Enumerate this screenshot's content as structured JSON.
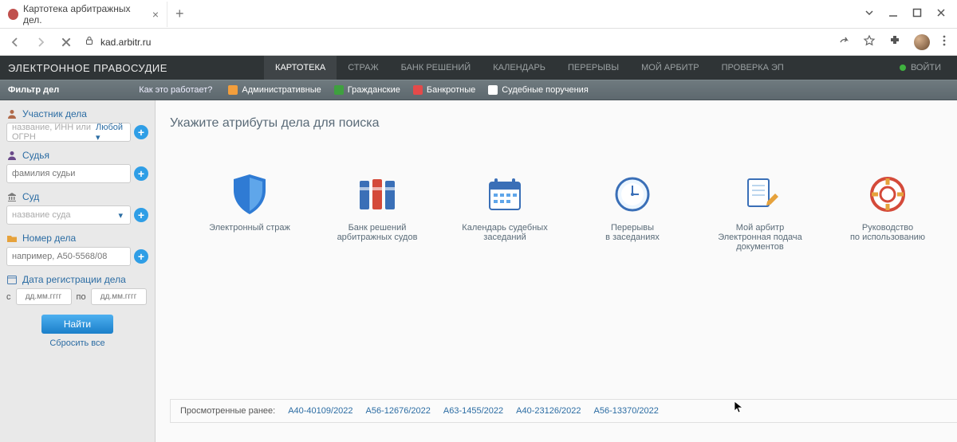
{
  "browser": {
    "tab_title": "Картотека арбитражных дел.",
    "url": "kad.arbitr.ru"
  },
  "header": {
    "brand": "ЭЛЕКТРОННОЕ ПРАВОСУДИЕ",
    "nav": [
      "КАРТОТЕКА",
      "СТРАЖ",
      "БАНК РЕШЕНИЙ",
      "КАЛЕНДАРЬ",
      "ПЕРЕРЫВЫ",
      "МОЙ АРБИТР",
      "ПРОВЕРКА ЭП"
    ],
    "login": "ВОЙТИ"
  },
  "filterbar": {
    "title": "Фильтр дел",
    "how": "Как это работает?",
    "chips": [
      "Административные",
      "Гражданские",
      "Банкротные",
      "Судебные поручения"
    ]
  },
  "sidebar": {
    "participant": {
      "label": "Участник дела",
      "placeholder": "название, ИНН или ОГРН",
      "dropdown": "Любой"
    },
    "judge": {
      "label": "Судья",
      "placeholder": "фамилия судьи"
    },
    "court": {
      "label": "Суд",
      "placeholder": "название суда"
    },
    "case": {
      "label": "Номер дела",
      "placeholder": "например, А50-5568/08"
    },
    "regdate": {
      "label": "Дата регистрации дела",
      "from": "с",
      "to": "по",
      "ph": "дд.мм.гггг"
    },
    "find": "Найти",
    "reset": "Сбросить все"
  },
  "main": {
    "hint": "Укажите атрибуты дела для поиска",
    "cards": [
      {
        "t1": "Электронный страж",
        "t2": "",
        "t3": ""
      },
      {
        "t1": "Банк решений",
        "t2": "арбитражных судов",
        "t3": ""
      },
      {
        "t1": "Календарь судебных",
        "t2": "заседаний",
        "t3": ""
      },
      {
        "t1": "Перерывы",
        "t2": "в заседаниях",
        "t3": ""
      },
      {
        "t1": "Мой арбитр",
        "t2": "Электронная подача",
        "t3": "документов"
      },
      {
        "t1": "Руководство",
        "t2": "по использованию",
        "t3": ""
      }
    ],
    "recent_label": "Просмотренные ранее:",
    "recent": [
      "А40-40109/2022",
      "А56-12676/2022",
      "А63-1455/2022",
      "А40-23126/2022",
      "А56-13370/2022"
    ]
  }
}
